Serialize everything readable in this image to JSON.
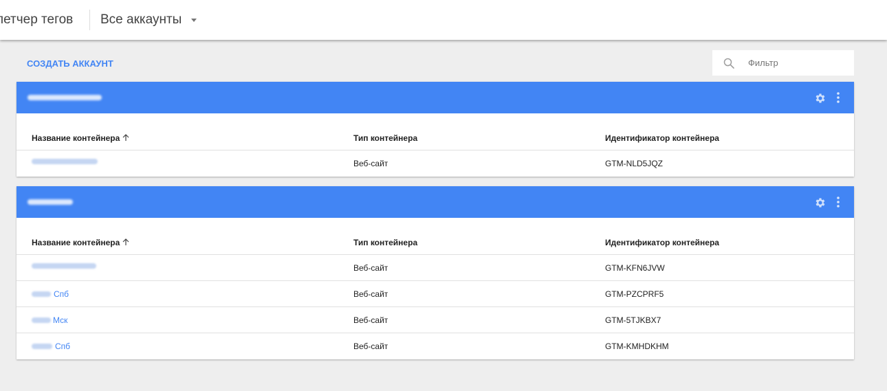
{
  "header": {
    "app_name": "летчер тегов",
    "account_switcher_label": "Все аккаунты"
  },
  "toolbar": {
    "create_account_label": "СОЗДАТЬ АККАУНТ",
    "filter_placeholder": "Фильтр"
  },
  "colors": {
    "accent": "#4285f4",
    "background": "#eeeeee"
  },
  "icons": {
    "search": "search-icon",
    "settings": "gear-icon",
    "more": "more-vert-icon",
    "sort": "arrow-up-icon",
    "dropdown": "caret-down-icon"
  },
  "table_columns": {
    "name": "Название контейнера",
    "type": "Тип контейнера",
    "id": "Идентификатор контейнера"
  },
  "accounts": [
    {
      "name": "",
      "containers": [
        {
          "name_suffix": "",
          "type": "Веб-сайт",
          "id": "GTM-NLD5JQZ"
        }
      ]
    },
    {
      "name": "",
      "containers": [
        {
          "name_suffix": "",
          "type": "Веб-сайт",
          "id": "GTM-KFN6JVW"
        },
        {
          "name_suffix": "Спб",
          "type": "Веб-сайт",
          "id": "GTM-PZCPRF5"
        },
        {
          "name_suffix": "Мск",
          "type": "Веб-сайт",
          "id": "GTM-5TJKBX7"
        },
        {
          "name_suffix": "Спб",
          "type": "Веб-сайт",
          "id": "GTM-KMHDKHM"
        }
      ]
    }
  ]
}
